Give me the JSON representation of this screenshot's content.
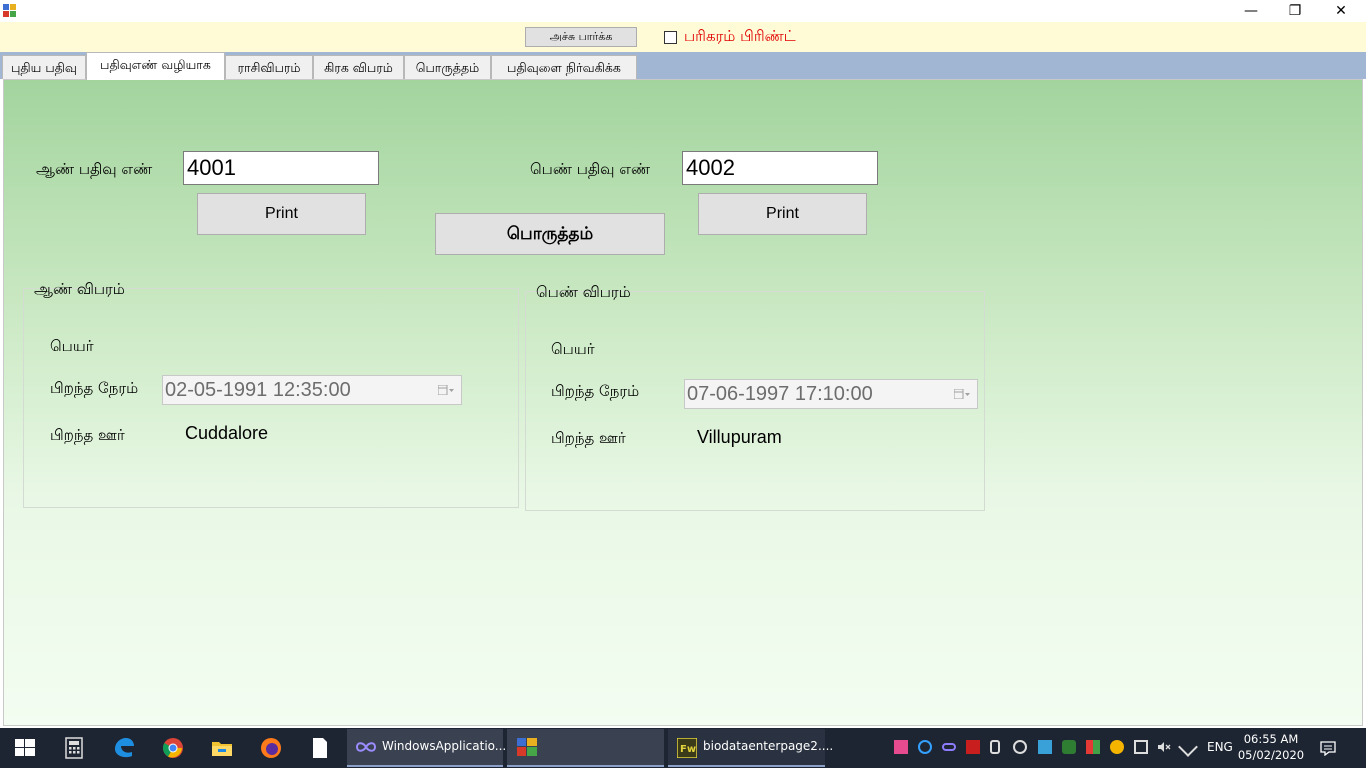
{
  "titlebar": {
    "minimize_glyph": "—",
    "restore_glyph": "❐",
    "close_glyph": "✕"
  },
  "toolbar": {
    "print_preview_label": "அச்சு பார்க்க",
    "remedy_print_label": "பரிகரம் பிரிண்ட்",
    "remedy_print_checked": false
  },
  "tabs": [
    {
      "label": "புதிய பதிவு"
    },
    {
      "label": "பதிவுஎண் வழியாக"
    },
    {
      "label": "ராசிவிபரம்"
    },
    {
      "label": "கிரக விபரம்"
    },
    {
      "label": "பொருத்தம்"
    },
    {
      "label": "பதிவுளை நிர்வகிக்க"
    }
  ],
  "active_tab": 1,
  "main": {
    "male_reg_label": "ஆண் பதிவு எண்",
    "male_reg_value": "4001",
    "female_reg_label": "பெண் பதிவு எண்",
    "female_reg_value": "4002",
    "print_label": "Print",
    "match_label": "பொருத்தம்",
    "male_group": {
      "title": "ஆண் விபரம்",
      "name_label": "பெயர்",
      "name_value": "",
      "birth_time_label": "பிறந்த நேரம்",
      "birth_time_value": "02-05-1991 12:35:00",
      "birth_place_label": "பிறந்த ஊர்",
      "birth_place_value": "Cuddalore"
    },
    "female_group": {
      "title": "பெண் விபரம்",
      "name_label": "பெயர்",
      "name_value": "",
      "birth_time_label": "பிறந்த நேரம்",
      "birth_time_value": "07-06-1997 17:10:00",
      "birth_place_label": "பிறந்த ஊர்",
      "birth_place_value": "Villupuram"
    }
  },
  "taskbar": {
    "apps": [
      {
        "label": "WindowsApplicatio...",
        "icon": "visual-studio-icon"
      },
      {
        "label": "",
        "icon": "app-window-icon"
      },
      {
        "label": "biodataenterpage2....",
        "icon": "fireworks-icon"
      }
    ],
    "language": "ENG",
    "time": "06:55 AM",
    "date": "05/02/2020"
  },
  "colors": {
    "panel_top": "#a3d49e",
    "panel_bottom": "#f3fdf1",
    "toolbar_bg": "#fffbd6",
    "tabstrip_bg": "#a0b6d2",
    "remedy_label": "#e00000",
    "taskbar_bg": "#1e2532"
  }
}
